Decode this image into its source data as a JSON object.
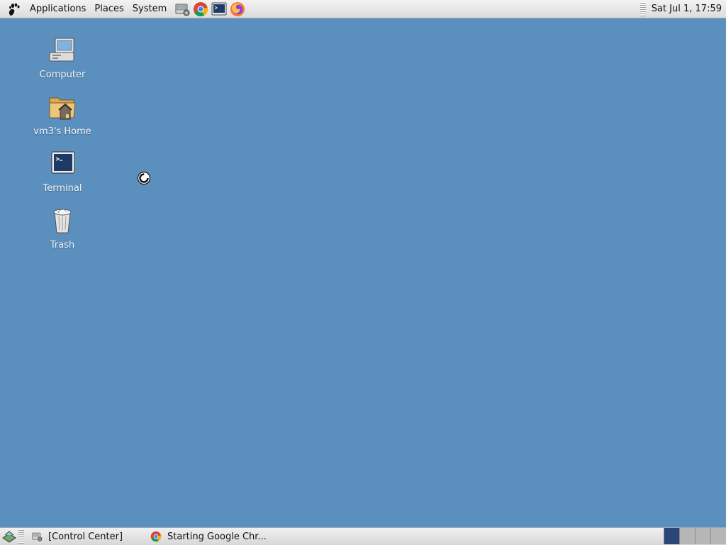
{
  "top_panel": {
    "menus": [
      "Applications",
      "Places",
      "System"
    ],
    "launchers": [
      "control-center-icon",
      "chrome-icon",
      "terminal-icon",
      "firefox-icon"
    ],
    "clock": "Sat Jul  1, 17:59"
  },
  "desktop": {
    "background_color": "#5b8fbd",
    "icons": [
      {
        "label": "Computer",
        "icon": "computer-icon"
      },
      {
        "label": "vm3's Home",
        "icon": "home-folder-icon"
      },
      {
        "label": "Terminal",
        "icon": "terminal-icon"
      },
      {
        "label": "Trash",
        "icon": "trash-icon"
      }
    ]
  },
  "bottom_panel": {
    "tasks": [
      {
        "label": "[Control Center]",
        "icon": "control-center-icon"
      },
      {
        "label": "Starting Google Chr...",
        "icon": "chrome-icon"
      }
    ],
    "workspaces": [
      {
        "active": true
      },
      {
        "active": false
      },
      {
        "active": false
      },
      {
        "active": false
      }
    ]
  }
}
